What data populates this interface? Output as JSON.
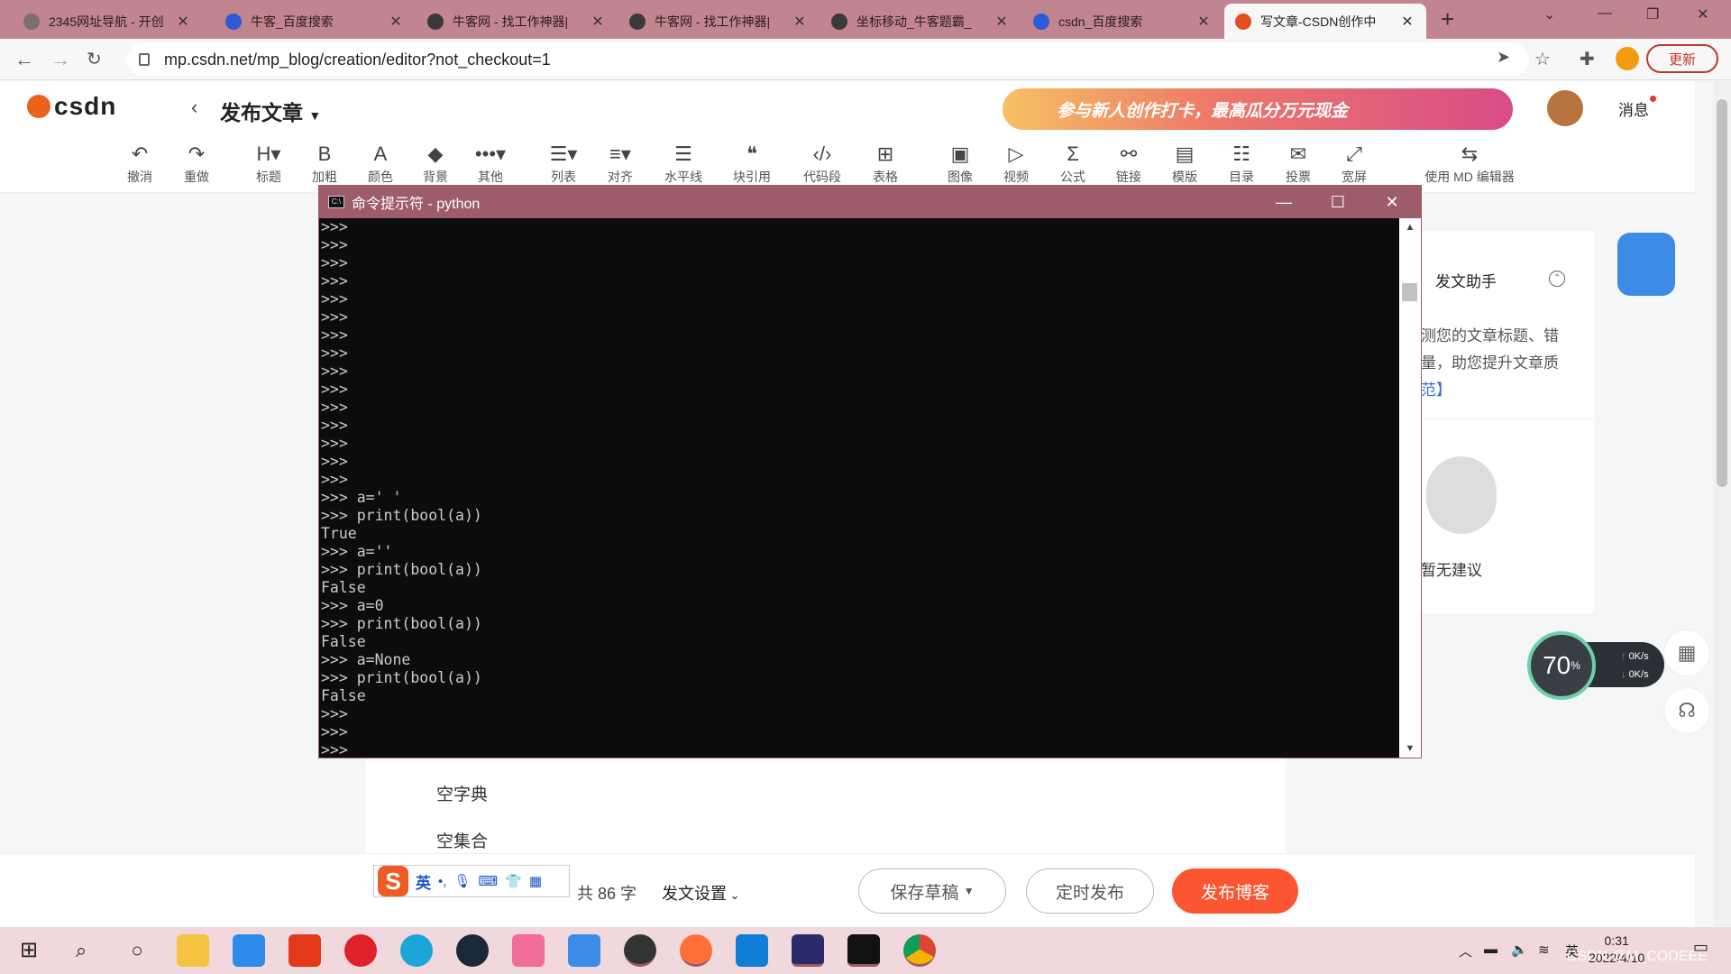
{
  "browser": {
    "tabs": [
      {
        "title": "2345网址导航 - 开创",
        "fav": "#7b6f6f"
      },
      {
        "title": "牛客_百度搜索",
        "fav": "#2b5bd7"
      },
      {
        "title": "牛客网 - 找工作神器|",
        "fav": "#3a3a3a"
      },
      {
        "title": "牛客网 - 找工作神器|",
        "fav": "#3a3a3a"
      },
      {
        "title": "坐标移动_牛客题霸_",
        "fav": "#3a3a3a"
      },
      {
        "title": "csdn_百度搜索",
        "fav": "#2b5bd7"
      },
      {
        "title": "写文章-CSDN创作中",
        "fav": "#e84b1e"
      }
    ],
    "url": "mp.csdn.net/mp_blog/creation/editor?not_checkout=1",
    "update_label": "更新"
  },
  "header": {
    "logo": "csdn",
    "page_title": "发布文章",
    "banner": "参与新人创作打卡，最高瓜分万元现金",
    "messages": "消息"
  },
  "toolbar": [
    {
      "icon": "↶",
      "label": "撤消"
    },
    {
      "icon": "↷",
      "label": "重做"
    },
    {
      "icon": "H▾",
      "label": "标题"
    },
    {
      "icon": "B",
      "label": "加粗"
    },
    {
      "icon": "A",
      "label": "颜色"
    },
    {
      "icon": "◆",
      "label": "背景"
    },
    {
      "icon": "•••▾",
      "label": "其他"
    },
    {
      "icon": "☰▾",
      "label": "列表"
    },
    {
      "icon": "≡▾",
      "label": "对齐"
    },
    {
      "icon": "☰",
      "label": "水平线"
    },
    {
      "icon": "❝",
      "label": "块引用"
    },
    {
      "icon": "‹/›",
      "label": "代码段"
    },
    {
      "icon": "⊞",
      "label": "表格"
    },
    {
      "icon": "▣",
      "label": "图像"
    },
    {
      "icon": "▷",
      "label": "视频"
    },
    {
      "icon": "Σ",
      "label": "公式"
    },
    {
      "icon": "⚯",
      "label": "链接"
    },
    {
      "icon": "▤",
      "label": "模版"
    },
    {
      "icon": "☷",
      "label": "目录"
    },
    {
      "icon": "✉",
      "label": "投票"
    },
    {
      "icon": "⤢",
      "label": "宽屏"
    },
    {
      "icon": "⇆",
      "label": "使用 MD 编辑器"
    }
  ],
  "editor": {
    "lines": [
      "空字典",
      "空集合"
    ]
  },
  "assistant": {
    "title": "发文助手",
    "text1": "测您的文章标题、错",
    "text2": "量，助您提升文章质",
    "link": "范】",
    "empty": "暂无建议"
  },
  "speed": {
    "percent": "70",
    "up": "0K/s",
    "down": "0K/s"
  },
  "bottom": {
    "ime_lang": "英",
    "ime_punct": "•,",
    "word_count": "共 86 字",
    "publish_settings": "发文设置",
    "save_draft": "保存草稿",
    "schedule": "定时发布",
    "publish": "发布博客"
  },
  "cmd": {
    "title": "命令提示符 - python",
    "lines": [
      ">>>",
      ">>>",
      ">>>",
      ">>>",
      ">>>",
      ">>>",
      ">>>",
      ">>>",
      ">>>",
      ">>>",
      ">>>",
      ">>>",
      ">>>",
      ">>>",
      ">>>",
      ">>> a=' '",
      ">>> print(bool(a))",
      "True",
      ">>> a=''",
      ">>> print(bool(a))",
      "False",
      ">>> a=0",
      ">>> print(bool(a))",
      "False",
      ">>> a=None",
      ">>> print(bool(a))",
      "False",
      ">>>",
      ">>>",
      ">>>"
    ]
  },
  "taskbar": {
    "time": "0:31",
    "date": "2022/4/10",
    "ime": "英",
    "watermark": "CSDN @M_CODEEE"
  },
  "colors": {
    "tabbar": "#c18590",
    "cmd_title": "#9d5c69",
    "publish": "#fc5531",
    "taskbar": "#f1d8dd"
  }
}
